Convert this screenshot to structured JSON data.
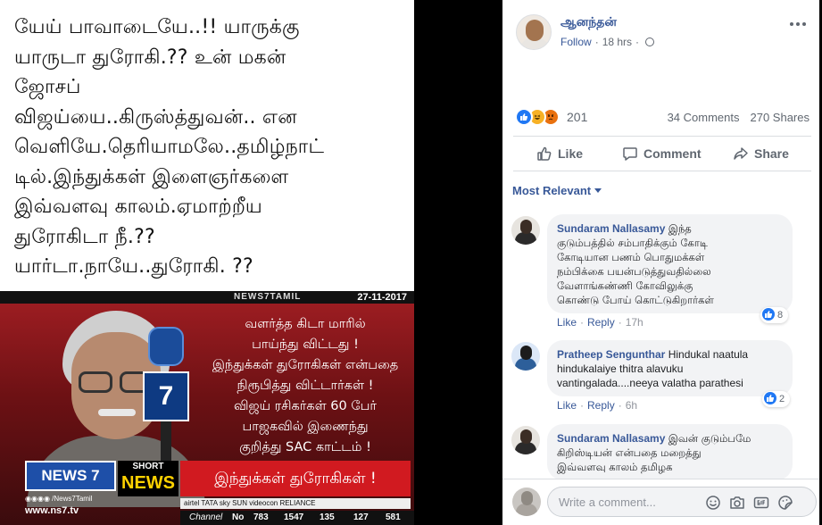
{
  "media": {
    "text_lines": [
      "யேய் பாவாடையே..!! யாருக்கு",
      "யாருடா துரோகி.?? உன் மகன்",
      "ஜோசப்",
      "விஜய்யை..கிருஸ்த்துவன்.. என",
      "வெளியே.தெரியாமலே..தமிழ்நாட்",
      "டில்.இந்துக்கள் இளைஞர்களை",
      "இவ்வளவு காலம்.ஏமாற்றீய",
      "துரோகிடா நீ.??",
      "யார்டா.நாயே..துரோகி. ??"
    ],
    "news": {
      "top_brand": "NEWS7TAMIL",
      "date": "27-11-2017",
      "mic_logo": "7",
      "quote_lines": [
        "வளர்த்த கிடா மாரில்",
        "பாய்ந்து விட்டது !",
        "இந்துக்கள் துரோகிகள் என்பதை",
        "நிரூபித்து விட்டார்கள் !",
        "விஜய் ரசிகர்கள் 60 பேர்",
        "பாஜகவில் இணைந்து",
        "குறித்து SAC காட்டம் !"
      ],
      "logo": "NEWS 7",
      "short_top": "SHORT",
      "short_bottom": "NEWS",
      "headline": "இந்துக்கள் துரோகிகள் !",
      "social": "◉◉◉◉ /News7Tamil",
      "website": "www.ns7.tv",
      "ticker": "airtel   TATA sky   SUN   videocon   RELIANCE",
      "channel_label": "Channel",
      "channel_no_label": "No",
      "channel_numbers": [
        "783",
        "1547",
        "135",
        "127",
        "581"
      ]
    }
  },
  "post": {
    "author": "ஆனந்தன்",
    "follow": "Follow",
    "separator": "·",
    "time": "18 hrs",
    "reaction_count": "201",
    "comments_count": "34 Comments",
    "shares_count": "270 Shares",
    "actions": {
      "like": "Like",
      "comment": "Comment",
      "share": "Share"
    },
    "sort_label": "Most Relevant"
  },
  "comments": [
    {
      "author": "Sundaram Nallasamy",
      "text_first": "இந்த",
      "text_lines": [
        "குடும்பத்தில் சம்பாதிக்கும் கோடி",
        "கோடியான பணம் பொதுமக்கள்",
        "நம்பிக்கை பயன்படுத்துவதில்லை",
        "வேளாங்கண்ணி கோவிலுக்கு",
        "கொண்டு போய் கொட்டுகிறார்கள்"
      ],
      "reaction_count": "8",
      "like": "Like",
      "reply": "Reply",
      "time": "17h"
    },
    {
      "author": "Pratheep Sengunthar",
      "text_first": "Hindukal naatula",
      "text_lines": [
        "hindukalaiye thitra alavuku",
        "vantingalada....neeya valatha parathesi"
      ],
      "reaction_count": "2",
      "like": "Like",
      "reply": "Reply",
      "time": "6h"
    },
    {
      "author": "Sundaram Nallasamy",
      "text_first": "இவன் குடும்பமே",
      "text_lines": [
        "கிறிஸ்டியன் என்பதை மறைத்து",
        "இவ்வளவு காலம் தமிழக"
      ]
    }
  ],
  "composer": {
    "placeholder": "Write a comment..."
  },
  "colors": {
    "link": "#385898",
    "like_blue": "#2078f4",
    "haha_yellow": "#f7b125",
    "angry_orange": "#e9710f",
    "news_red": "#d11a20"
  }
}
